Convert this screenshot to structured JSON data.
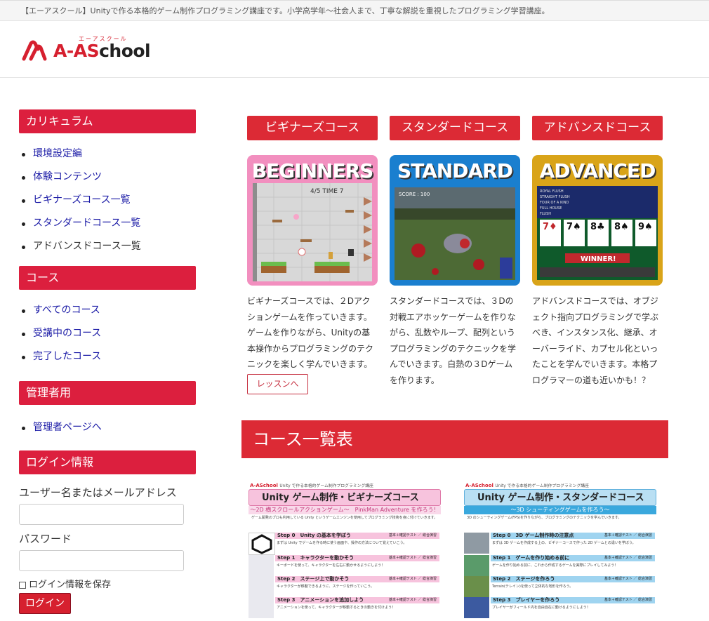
{
  "site": {
    "tagline": "【エーアスクール】Unityで作る本格的ゲーム制作プログラミング講座です。小学高学年～社会人まで、丁寧な解説を重視したプログラミング学習講座。",
    "logo_main": "A-AS",
    "logo_school": "chool",
    "logo_ruby": "エーアスクール"
  },
  "sidebar": {
    "curriculum_heading": "カリキュラム",
    "curriculum_items": [
      "環境設定編",
      "体験コンテンツ",
      "ビギナーズコース一覧",
      "スタンダードコース一覧",
      "アドバンスドコース一覧"
    ],
    "course_heading": "コース",
    "course_items": [
      "すべてのコース",
      "受講中のコース",
      "完了したコース"
    ],
    "admin_heading": "管理者用",
    "admin_items": [
      "管理者ページへ"
    ],
    "login_heading": "ログイン情報",
    "username_label": "ユーザー名またはメールアドレス",
    "password_label": "パスワード",
    "remember_label": "ログイン情報を保存",
    "login_button": "ログイン"
  },
  "courses": [
    {
      "button": "ビギナーズコース",
      "card_title": "BEGINNERS",
      "desc": "ビギナーズコースでは、２Dアクションゲームを作っていきます。ゲームを作りながら、Unityの基本操作からプログラミングのテクニックを楽しく学んでいきます。",
      "hud": "4/5  TIME 7",
      "color": "#f28fbf"
    },
    {
      "button": "スタンダードコース",
      "card_title": "STANDARD",
      "desc": "スタンダードコースでは、３Dの対戦エアホッケーゲームを作りながら、乱数やループ、配列というプログラミングのテクニックを学んでいきます。白熱の３Dゲームを作ります。",
      "hud": "SCORE : 100",
      "color": "#1a7fcf"
    },
    {
      "button": "アドバンスドコース",
      "card_title": "ADVANCED",
      "desc": "アドバンスドコースでは、オブジェクト指向プログラミングで学ぶべき、インスタンス化、継承、オーバーライド、カプセル化といったことを学んでいきます。本格プログラマーの道も近いかも！？",
      "hud": "WINNER!",
      "color": "#d9a419"
    }
  ],
  "lesson_button": "レッスンへ",
  "list_heading": "コース一覧表",
  "docs": [
    {
      "brand": "A-ASchool",
      "brand_sub": "Unity で作る本格的ゲーム制作プログラミング講座",
      "title": "Unity ゲーム制作・ビギナーズコース",
      "subtitle": "～2D 横スクロールアクションゲーム～　PinkMan Adventure を作ろう！",
      "intro": "ゲーム開発のプロも利用している Unity というゲームエンジンを使用してプログラミング技術を身に付けていきます。",
      "tag": "基本＋確認テスト ／ 総合演習",
      "steps": [
        {
          "title": "Step 0　Unity の基本を学ぼう",
          "text": "まずは Unity でゲームを作る時に使う画面や、操作の方法について覚えていこう。"
        },
        {
          "title": "Step 1　キャラクターを動かそう",
          "text": "キーボードを使って、キャラクターを左右に動かせるようにしよう！"
        },
        {
          "title": "Step 2　ステージ上で動かそう",
          "text": "キャラクターが移動できるように、ステージを作っていこう。"
        },
        {
          "title": "Step 3　アニメーションを追加しよう",
          "text": "アニメーションを使って、キャラクターが移動するときの動きを付けよう！"
        }
      ]
    },
    {
      "brand": "A-ASchool",
      "brand_sub": "Unity で作る本格的ゲーム制作プログラミング講座",
      "title": "Unity ゲーム制作・スタンダードコース",
      "subtitle": "～3D シューティングゲームを作ろう～",
      "intro": "3D のシューティングゲーム(FPS)を作りながら、プログラミングのテクニックを学んでいきます。",
      "tag": "基本＋確認テスト ／ 総合演習",
      "steps": [
        {
          "title": "Step 0　3D ゲーム制作時の注意点",
          "text": "まずは 3D ゲームを作成する上の、ビギナーコースで作った 2D ゲームとの違いを学ぼう。"
        },
        {
          "title": "Step 1　ゲームを作り始める前に",
          "text": "ゲームを作り始める前に、これから作成するゲームを実際にプレイしてみよう！"
        },
        {
          "title": "Step 2　ステージを作ろう",
          "text": "Terrain(テレイン)を使って立体的な地形を作ろう。"
        },
        {
          "title": "Step 3　プレイヤーを作ろう",
          "text": "プレイヤーがフィールド内を自由自在に動けるようにしよう！"
        }
      ]
    }
  ]
}
